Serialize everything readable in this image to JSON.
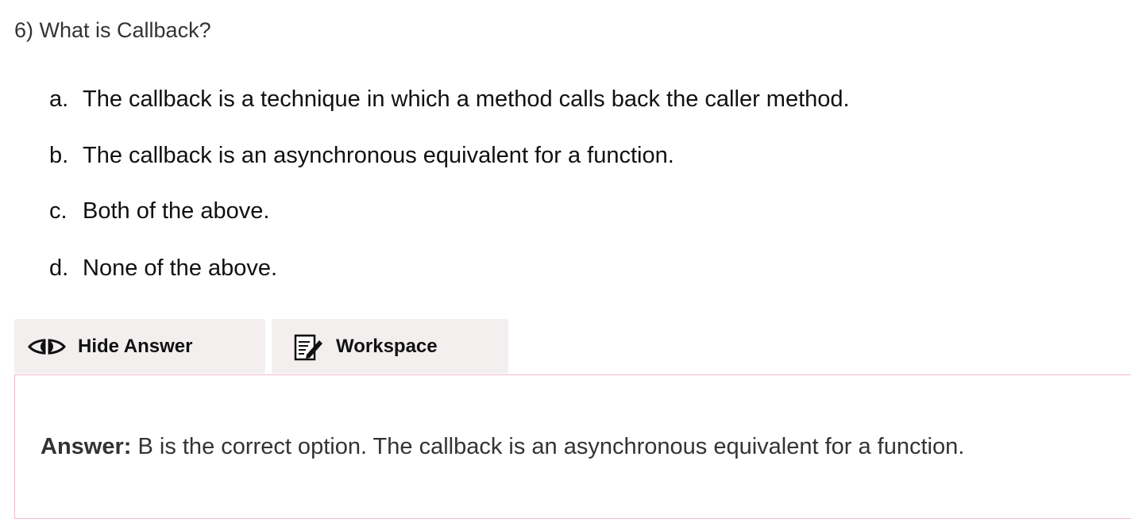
{
  "question": {
    "text": "6) What is Callback?"
  },
  "options": [
    {
      "letter": "a.",
      "text": "The callback is a technique in which a method calls back the caller method."
    },
    {
      "letter": "b.",
      "text": "The callback is an asynchronous equivalent for a function."
    },
    {
      "letter": "c.",
      "text": "Both of the above."
    },
    {
      "letter": "d.",
      "text": "None of the above."
    }
  ],
  "buttons": {
    "hide_answer": {
      "label": "Hide Answer",
      "icon": "eye-icon"
    },
    "workspace": {
      "label": "Workspace",
      "icon": "notepad-edit-icon"
    }
  },
  "answer": {
    "label": "Answer:",
    "text": " B is the correct option. The callback is an asynchronous equivalent for a function."
  },
  "colors": {
    "button_bg": "#f3efef",
    "answer_border": "#f2b8cc"
  }
}
